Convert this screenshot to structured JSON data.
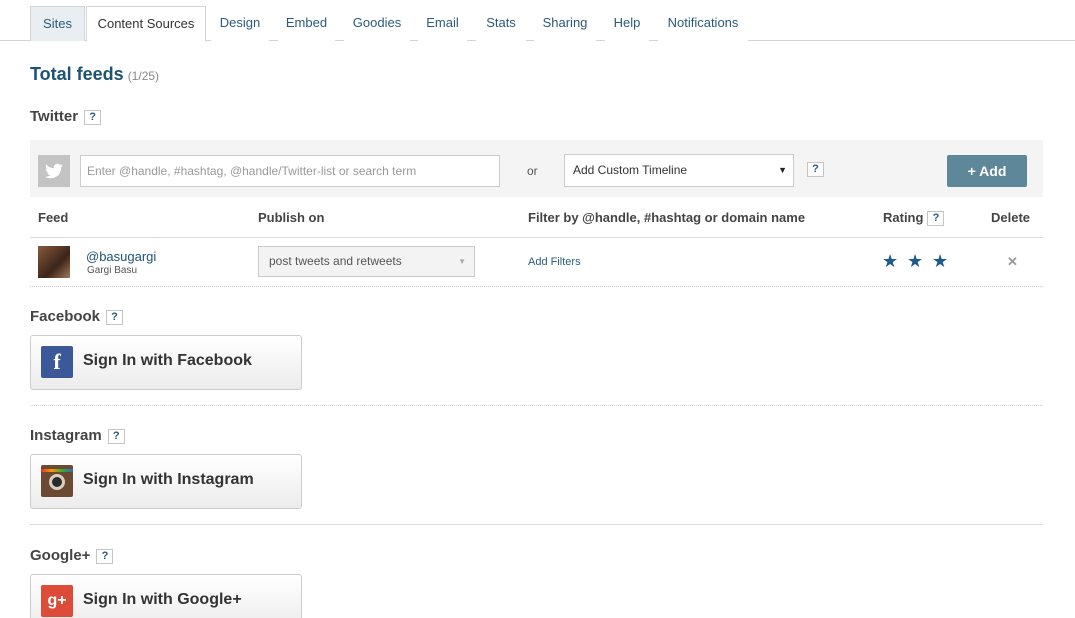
{
  "tabs": [
    {
      "label": "Sites"
    },
    {
      "label": "Content Sources"
    },
    {
      "label": "Design"
    },
    {
      "label": "Embed"
    },
    {
      "label": "Goodies"
    },
    {
      "label": "Email"
    },
    {
      "label": "Stats"
    },
    {
      "label": "Sharing"
    },
    {
      "label": "Help"
    },
    {
      "label": "Notifications"
    }
  ],
  "active_tab": "Content Sources",
  "total_feeds": {
    "title": "Total feeds",
    "count": "(1/25)"
  },
  "help_label": "?",
  "twitter": {
    "heading": "Twitter",
    "input_placeholder": "Enter @handle, #hashtag, @handle/Twitter-list or search term",
    "or_text": "or",
    "timeline_select": "Add Custom Timeline",
    "add_button": "+ Add",
    "columns": {
      "feed": "Feed",
      "publish_on": "Publish on",
      "filter": "Filter by @handle, #hashtag or domain name",
      "rating": "Rating",
      "delete": "Delete"
    },
    "feeds": [
      {
        "handle": "@basugargi",
        "name": "Gargi Basu",
        "publish_on": "post tweets and retweets",
        "filters_link": "Add Filters",
        "rating": 3
      }
    ]
  },
  "facebook": {
    "heading": "Facebook",
    "button": "Sign In with Facebook",
    "icon": "facebook-icon"
  },
  "instagram": {
    "heading": "Instagram",
    "button": "Sign In with Instagram",
    "icon": "instagram-icon"
  },
  "googleplus": {
    "heading": "Google+",
    "button": "Sign In with Google+",
    "icon": "google-plus-icon"
  },
  "colors": {
    "accent": "#5e8799",
    "link": "#2a5b7a",
    "heading": "#1d5373",
    "star": "#1d5a8c"
  }
}
